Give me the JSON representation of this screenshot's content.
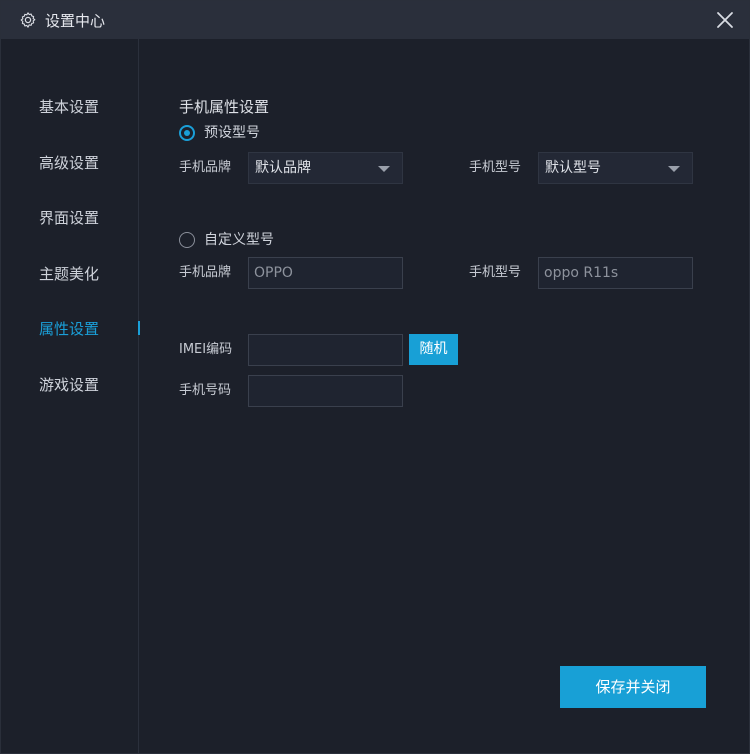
{
  "titlebar": {
    "title": "设置中心",
    "icon": "gear-icon",
    "close_icon": "close-icon"
  },
  "sidebar": {
    "items": [
      {
        "label": "基本设置"
      },
      {
        "label": "高级设置"
      },
      {
        "label": "界面设置"
      },
      {
        "label": "主题美化"
      },
      {
        "label": "属性设置",
        "active": true
      },
      {
        "label": "游戏设置"
      }
    ]
  },
  "main": {
    "section_title": "手机属性设置",
    "preset": {
      "label": "预设型号",
      "checked": true,
      "brand_label": "手机品牌",
      "brand_value": "默认品牌",
      "model_label": "手机型号",
      "model_value": "默认型号"
    },
    "custom": {
      "label": "自定义型号",
      "checked": false,
      "brand_label": "手机品牌",
      "brand_value": "OPPO",
      "model_label": "手机型号",
      "model_value": "oppo R11s"
    },
    "imei": {
      "label": "IMEI编码",
      "value": "",
      "random_button": "随机"
    },
    "phone": {
      "label": "手机号码",
      "value": ""
    },
    "save_button": "保存并关闭"
  },
  "colors": {
    "accent": "#1a9fd8",
    "background": "#1c202a",
    "titlebar": "#2a2f3b"
  }
}
